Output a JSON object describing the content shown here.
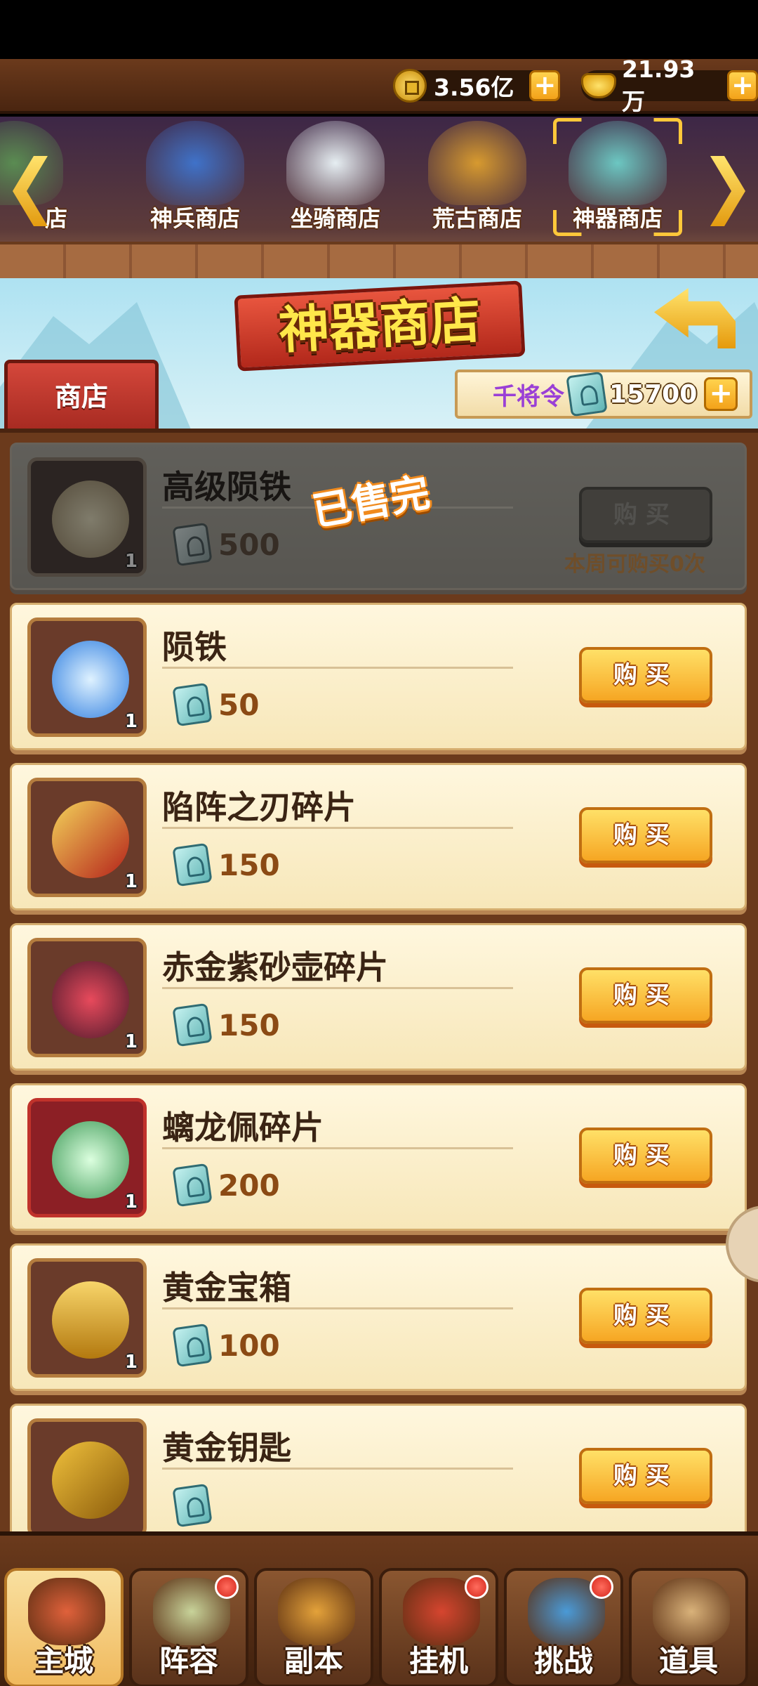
{
  "currency": {
    "coins": "3.56亿",
    "gold": "21.93万"
  },
  "tabs": [
    {
      "label": "店",
      "color": "#5a8c52"
    },
    {
      "label": "神兵商店",
      "color": "#3f72c9"
    },
    {
      "label": "坐骑商店",
      "color": "#e6eef2"
    },
    {
      "label": "荒古商店",
      "color": "#d79a2f"
    },
    {
      "label": "神器商店",
      "color": "#6cc7c2"
    }
  ],
  "header": {
    "title": "神器商店",
    "shop_label": "商店",
    "token_label": "千将令",
    "token_value": "15700"
  },
  "items": [
    {
      "name": "高级陨铁",
      "qty": "1",
      "price": "500",
      "buy": "购买",
      "sold_out": true,
      "color": "#e3b22b"
    },
    {
      "name": "陨铁",
      "qty": "1",
      "price": "50",
      "buy": "购买",
      "sold_out": false,
      "color": "#5aa8f2"
    },
    {
      "name": "陷阵之刃碎片",
      "qty": "1",
      "price": "150",
      "buy": "购买",
      "sold_out": false,
      "color": "#d44236"
    },
    {
      "name": "赤金紫砂壶碎片",
      "qty": "1",
      "price": "150",
      "buy": "购买",
      "sold_out": false,
      "color": "#c2304a"
    },
    {
      "name": "螭龙佩碎片",
      "qty": "1",
      "price": "200",
      "buy": "购买",
      "sold_out": false,
      "color": "#9fe0a6"
    },
    {
      "name": "黄金宝箱",
      "qty": "1",
      "price": "100",
      "buy": "购买",
      "sold_out": false,
      "color": "#e7b43a"
    },
    {
      "name": "黄金钥匙",
      "qty": "",
      "price": "",
      "buy": "购买",
      "sold_out": false,
      "color": "#d6a12b"
    }
  ],
  "soldout": {
    "stamp": "已售完",
    "limit": "本周可购买0次"
  },
  "nav": [
    {
      "label": "主城",
      "badge": false,
      "color": "#e0613b"
    },
    {
      "label": "阵容",
      "badge": true,
      "color": "#c8d39a"
    },
    {
      "label": "副本",
      "badge": false,
      "color": "#e4a23a"
    },
    {
      "label": "挂机",
      "badge": true,
      "color": "#d6452f"
    },
    {
      "label": "挑战",
      "badge": true,
      "color": "#4a9ad7"
    },
    {
      "label": "道具",
      "badge": false,
      "color": "#d9b27a"
    }
  ]
}
